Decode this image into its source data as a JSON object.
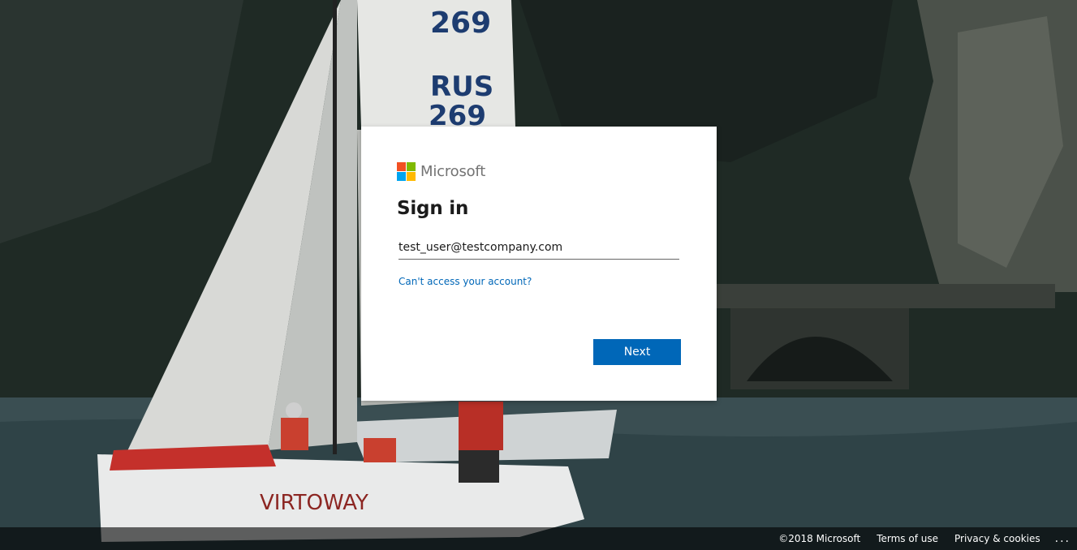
{
  "brand": {
    "name": "Microsoft",
    "colors": {
      "red": "#f25022",
      "green": "#7fba00",
      "blue": "#00a4ef",
      "yellow": "#ffb900"
    }
  },
  "signin": {
    "title": "Sign in",
    "email_value": "test_user@testcompany.com",
    "cant_access_link": "Can't access your account?",
    "next_button": "Next",
    "accent_color": "#0067b8"
  },
  "background_image": {
    "sail_number_top": "269",
    "sail_country": "RUS",
    "sail_number": "269",
    "boat_name": "VIRTOWAY"
  },
  "footer": {
    "copyright": "©2018 Microsoft",
    "terms": "Terms of use",
    "privacy": "Privacy & cookies",
    "more": "..."
  }
}
